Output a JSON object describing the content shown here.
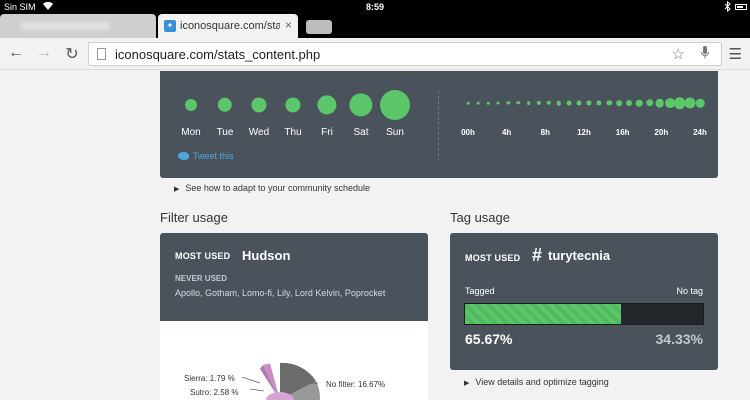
{
  "status": {
    "carrier": "Sin SIM",
    "time": "8:59"
  },
  "browser": {
    "active_tab_title": "iconosquare.com/stats_c",
    "url": "iconosquare.com/stats_content.php"
  },
  "schedule": {
    "days": [
      {
        "label": "Mon",
        "level": 0.25
      },
      {
        "label": "Tue",
        "level": 0.35
      },
      {
        "label": "Wed",
        "level": 0.38
      },
      {
        "label": "Thu",
        "level": 0.38
      },
      {
        "label": "Fri",
        "level": 0.55
      },
      {
        "label": "Sat",
        "level": 0.72
      },
      {
        "label": "Sun",
        "level": 1.0
      }
    ],
    "hours": [
      0.05,
      0.05,
      0.05,
      0.08,
      0.1,
      0.12,
      0.15,
      0.18,
      0.2,
      0.22,
      0.24,
      0.25,
      0.26,
      0.27,
      0.28,
      0.3,
      0.33,
      0.38,
      0.45,
      0.55,
      0.65,
      0.8,
      0.75,
      0.55
    ],
    "hour_labels": [
      "00h",
      "4h",
      "8h",
      "12h",
      "16h",
      "20h",
      "24h"
    ],
    "tweet_label": "Tweet this",
    "bubble_color": "#5cc76a"
  },
  "adapt_link": "See how to adapt to your community schedule",
  "filter_usage": {
    "title": "Filter usage",
    "most_used_label": "MOST USED",
    "most_used_value": "Hudson",
    "never_used_label": "NEVER USED",
    "never_used_list": "Apollo, Gotham, Lomo-fi, Lily, Lord Kelvin, Poprocket",
    "pie_labels": [
      "Sierra: 1.79 %",
      "Sutro: 2.58 %",
      "No filter: 16.67%"
    ]
  },
  "tag_usage": {
    "title": "Tag usage",
    "most_used_label": "MOST USED",
    "most_used_tag": "turytecnia",
    "hash_symbol": "#",
    "tagged_label": "Tagged",
    "no_tag_label": "No tag",
    "tagged_pct": "65.67%",
    "no_tag_pct": "34.33%",
    "tagged_fraction": 0.6567,
    "details_link": "View details and optimize tagging",
    "accent": "#5cc76a"
  }
}
